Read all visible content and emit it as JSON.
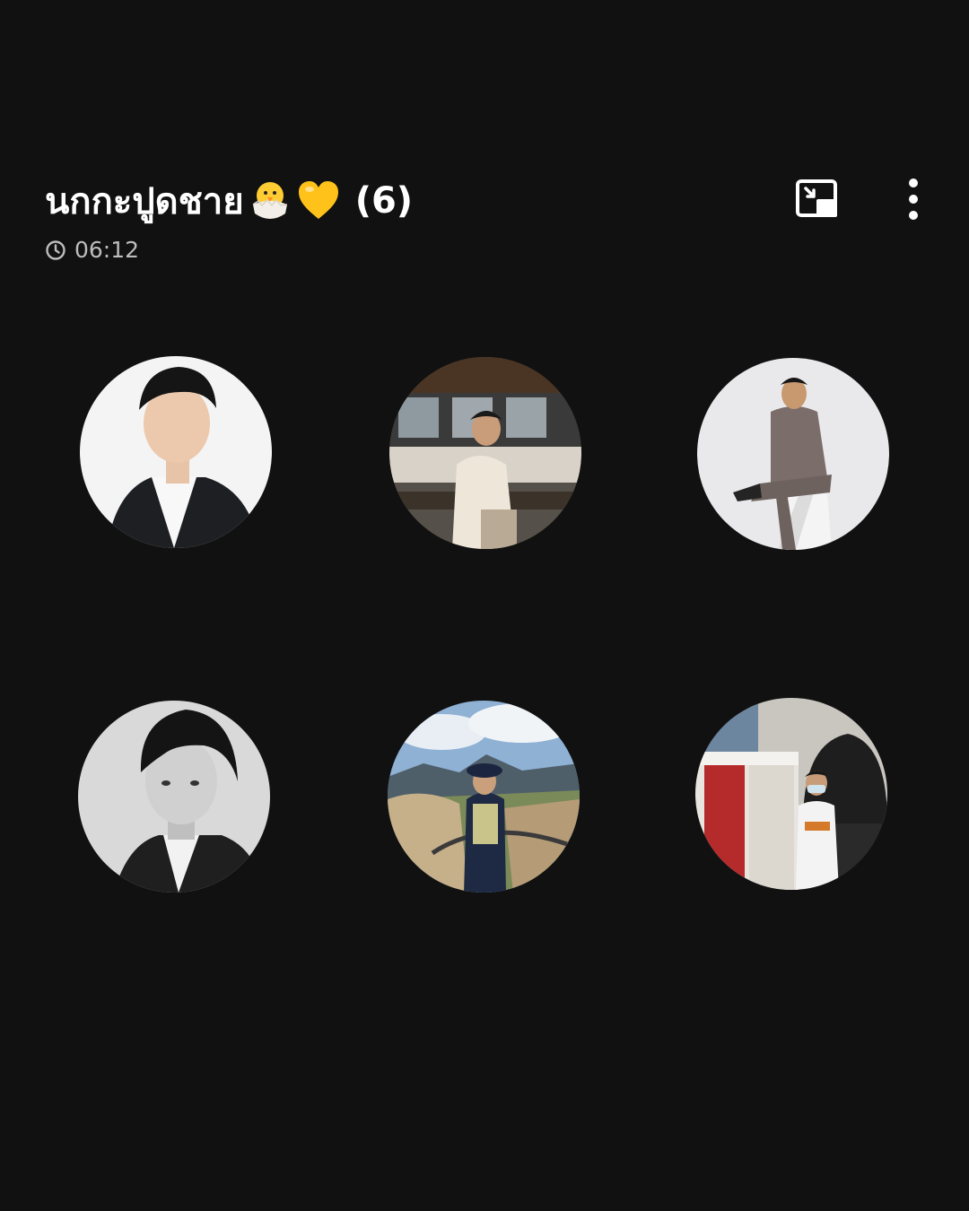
{
  "header": {
    "title": "นกกะปูดชาย",
    "count": "(6)",
    "emojis": [
      "hatching-chick-emoji",
      "yellow-heart-emoji"
    ],
    "pip_icon": "picture-in-picture-icon",
    "more_icon": "more-vertical-icon"
  },
  "status": {
    "icon": "clock-icon",
    "time": "06:12"
  },
  "participants": [
    {
      "label": "participant-1",
      "photo": "man in black blazer, white shirt, light background"
    },
    {
      "label": "participant-2",
      "photo": "man in cream jacket sitting on bench by building"
    },
    {
      "label": "participant-3",
      "photo": "man in grey suit on director chair"
    },
    {
      "label": "participant-4",
      "photo": "black and white portrait of man"
    },
    {
      "label": "participant-5",
      "photo": "man on rocky cliff with mountain view"
    },
    {
      "label": "participant-6",
      "photo": "man in white tee near red curtain booth"
    }
  ],
  "colors": {
    "background": "#111111",
    "text": "#ffffff",
    "subtext": "#bdbdbd"
  }
}
